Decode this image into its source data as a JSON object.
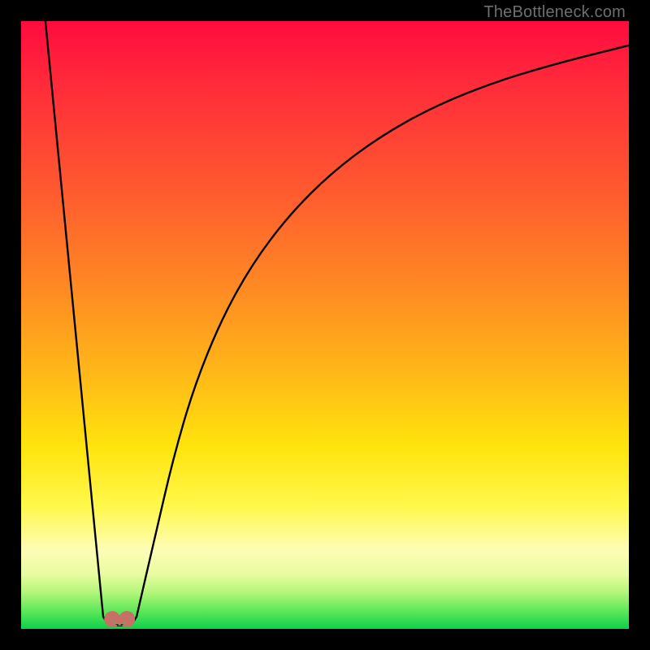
{
  "watermark": "TheBottleneck.com",
  "chart_data": {
    "type": "line",
    "title": "",
    "xlabel": "",
    "ylabel": "",
    "xlim": [
      0,
      100
    ],
    "ylim": [
      0,
      100
    ],
    "series": [
      {
        "name": "left-falling-line",
        "x": [
          4,
          13.5
        ],
        "values": [
          100,
          2
        ]
      },
      {
        "name": "valley-floor",
        "x": [
          13.5,
          14.2,
          15.8,
          17.0,
          18.3,
          19.0
        ],
        "values": [
          2,
          0.9,
          0.6,
          0.6,
          0.9,
          2
        ]
      },
      {
        "name": "right-rising-curve",
        "x": [
          19.0,
          22,
          25,
          28.5,
          33,
          38,
          44,
          51,
          59,
          68,
          78,
          88,
          100
        ],
        "values": [
          2,
          15,
          28,
          40,
          51,
          60,
          68,
          75,
          81,
          86,
          90,
          93,
          96
        ]
      }
    ],
    "marker": {
      "name": "valley-lobe-marker",
      "color": "#c77066",
      "cx": 16.2,
      "cy": 1.6,
      "shape": "rounded-lobes"
    },
    "background_gradient": {
      "top": "#ff0b3f",
      "mid_orange": "#ff8a23",
      "mid_yellow": "#ffe40d",
      "pale": "#fdfdb5",
      "green": "#0ed14a"
    }
  }
}
